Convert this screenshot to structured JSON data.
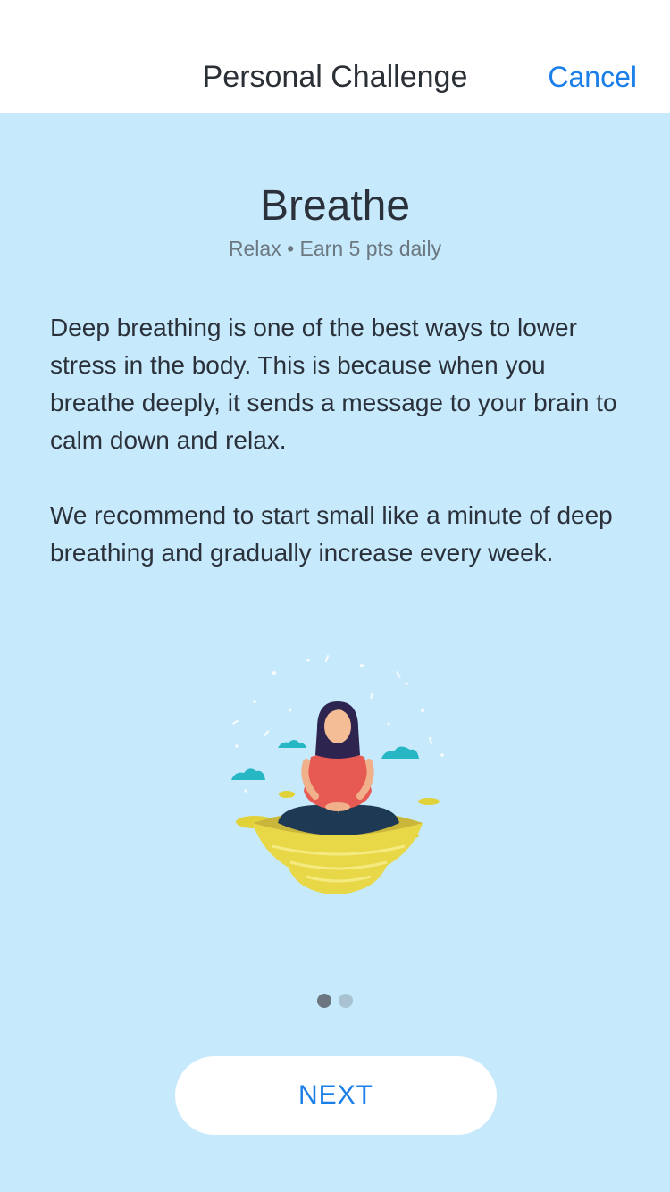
{
  "navbar": {
    "title": "Personal Challenge",
    "cancel_label": "Cancel"
  },
  "challenge": {
    "title": "Breathe",
    "subtitle": "Relax • Earn 5 pts daily",
    "paragraphs": [
      "Deep breathing is one of the best ways to lower stress in the body. This is because when you breathe deeply, it sends a message to your brain to calm down and relax.",
      "We recommend to start small like a minute of deep breathing and gradually increase every week."
    ],
    "illustration": "meditation-illustration"
  },
  "pager": {
    "current": 1,
    "total": 2
  },
  "footer": {
    "next_label": "NEXT"
  },
  "colors": {
    "background": "#c6e9fc",
    "accent": "#1a7fe8",
    "dot_active": "#6b7680",
    "dot_inactive": "#a9c2d2"
  }
}
